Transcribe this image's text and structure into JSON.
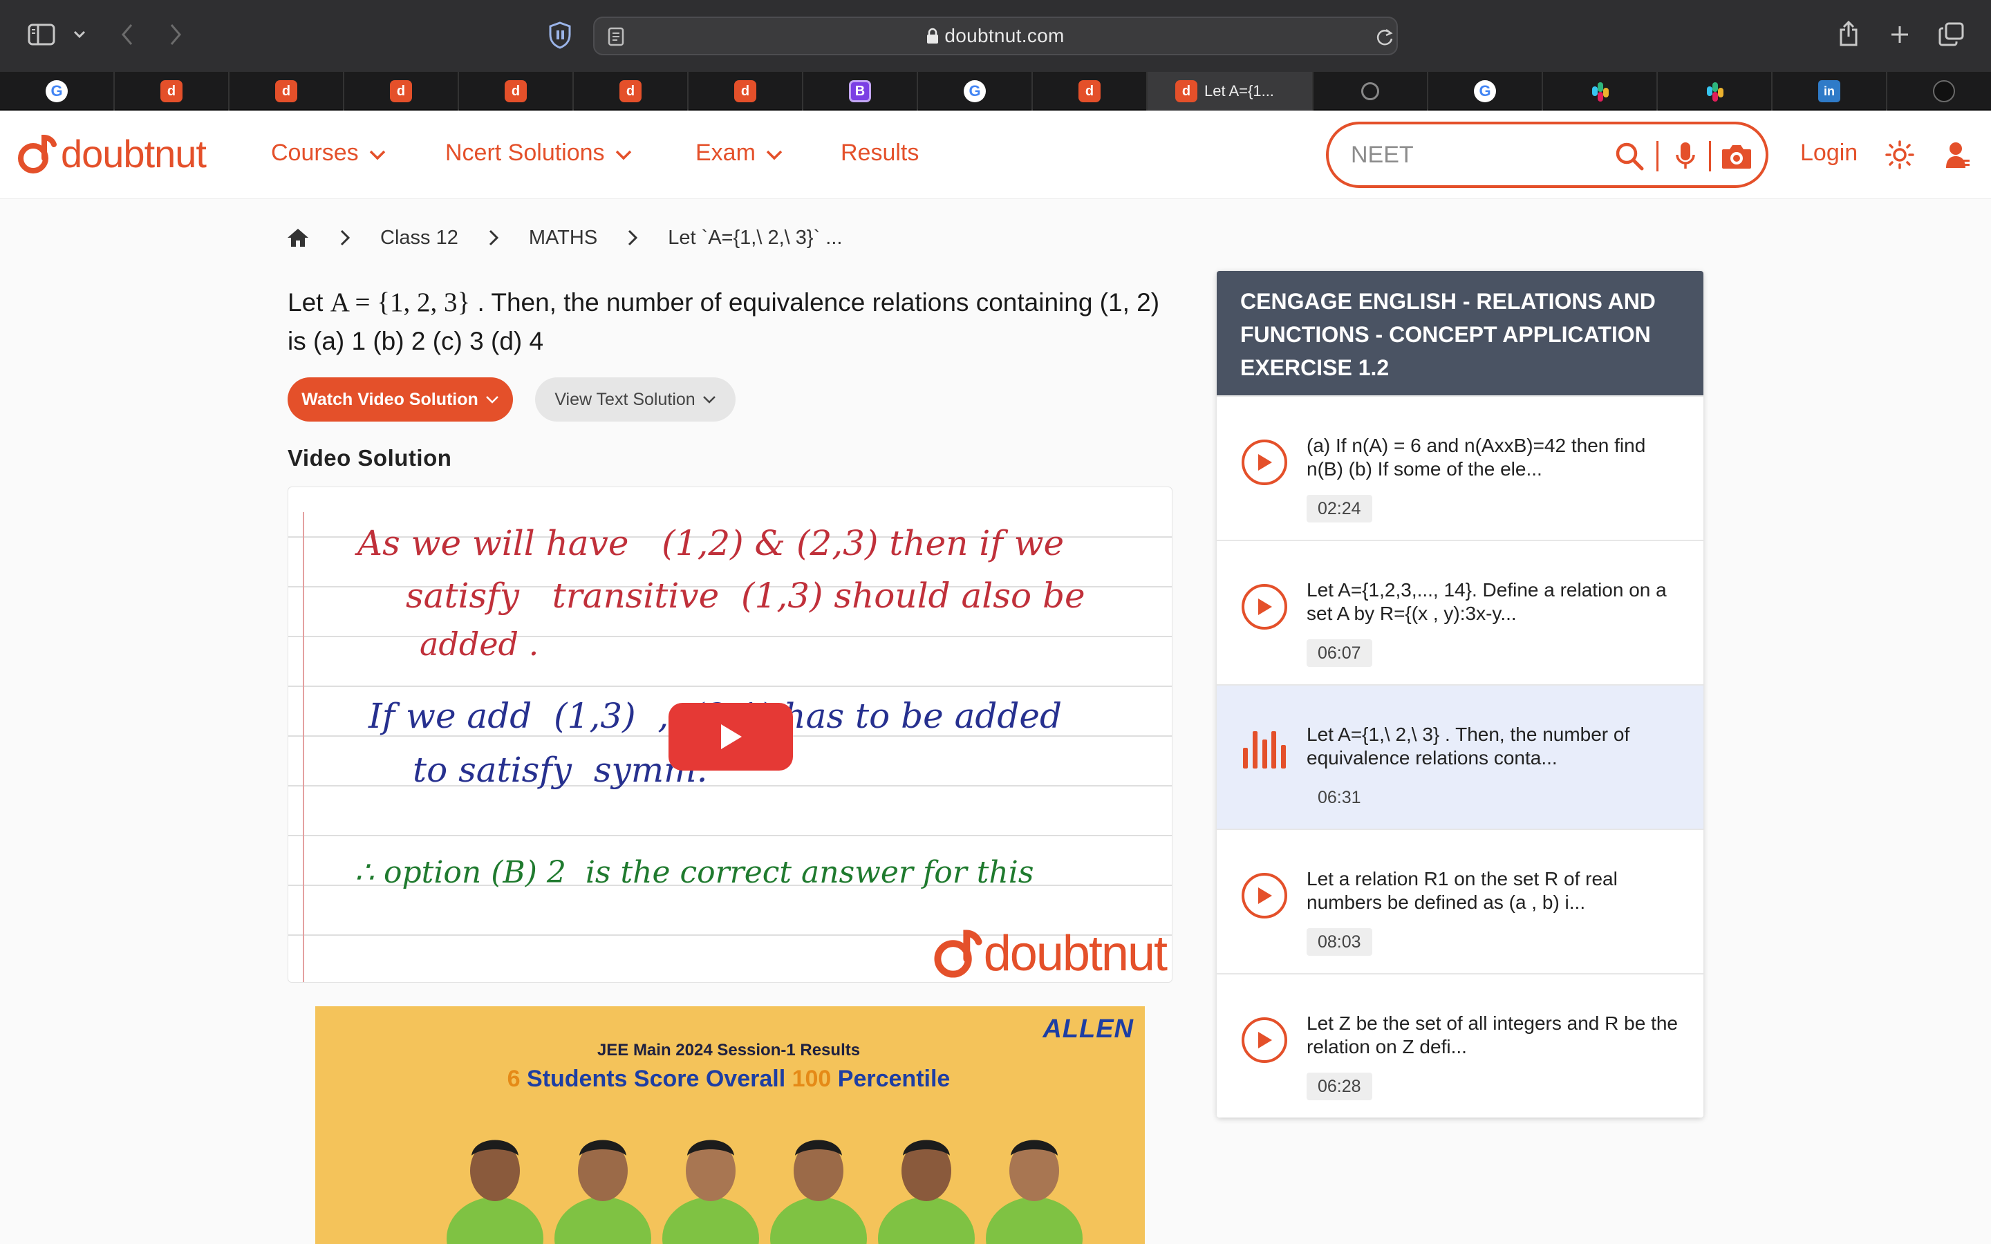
{
  "browser": {
    "url": "doubtnut.com",
    "active_tab_title": "Let A={1..."
  },
  "tabs": [
    {
      "icon": "google-favicon-icon",
      "letter": "G"
    },
    {
      "icon": "doubtnut-favicon-icon",
      "letter": "d"
    },
    {
      "icon": "doubtnut-favicon-icon",
      "letter": "d"
    },
    {
      "icon": "doubtnut-favicon-icon",
      "letter": "d"
    },
    {
      "icon": "doubtnut-favicon-icon",
      "letter": "d"
    },
    {
      "icon": "doubtnut-favicon-icon",
      "letter": "d"
    },
    {
      "icon": "doubtnut-favicon-icon",
      "letter": "d"
    },
    {
      "icon": "bootstrap-favicon-icon",
      "letter": "B"
    },
    {
      "icon": "google-favicon-icon",
      "letter": "G"
    },
    {
      "icon": "doubtnut-favicon-icon",
      "letter": "d"
    },
    {
      "icon": "doubtnut-favicon-icon",
      "letter": "d",
      "active": true
    },
    {
      "icon": "compass-favicon-icon",
      "letter": ""
    },
    {
      "icon": "google-favicon-icon",
      "letter": "G"
    },
    {
      "icon": "slack-favicon-icon",
      "letter": ""
    },
    {
      "icon": "slack-favicon-icon",
      "letter": ""
    },
    {
      "icon": "linkedin-favicon-icon",
      "letter": "in"
    },
    {
      "icon": "openai-favicon-icon",
      "letter": ""
    }
  ],
  "header": {
    "logo_text": "doubtnut",
    "nav": {
      "courses": "Courses",
      "ncert": "Ncert Solutions",
      "exam": "Exam",
      "results": "Results"
    },
    "search_placeholder": "NEET",
    "login": "Login"
  },
  "breadcrumb": {
    "class": "Class 12",
    "subject": "MATHS",
    "current": "Let `A={1,\\ 2,\\ 3}` ..."
  },
  "question": {
    "prefix": "Let ",
    "math": "A = {1,  2,  3}",
    "suffix": " . Then, the number of equivalence relations containing (1, 2) is (a) 1 (b) 2 (c) 3 (d) 4"
  },
  "buttons": {
    "watch_video": "Watch Video Solution",
    "view_text": "View Text Solution"
  },
  "video_section_title": "Video Solution",
  "video": {
    "handwriting": [
      {
        "text": "As we will have   (1,2) & (2,3) then if we",
        "color": "#c0303a"
      },
      {
        "text": "satisfy   transitive  (1,3) should also be",
        "color": "#c0303a"
      },
      {
        "text": "added .",
        "color": "#c0303a"
      },
      {
        "text": "If we add  (1,3)  ,  (3,1) has to be added",
        "color": "#26308f"
      },
      {
        "text": "to satisfy  symm.",
        "color": "#26308f"
      },
      {
        "text": "∴ option (B) 2  is the correct answer for this",
        "color": "#1f7a2e"
      }
    ],
    "watermark": "doubtnut"
  },
  "ad": {
    "brand": "ALLEN",
    "subtitle": "JEE Main 2024 Session-1 Results",
    "title_num1": "6",
    "title_mid": " Students Score Overall ",
    "title_num2": "100",
    "title_end": " Percentile"
  },
  "sidebar": {
    "heading": "CENGAGE ENGLISH  -  RELATIONS AND FUNCTIONS  -  CONCEPT APPLICATION EXERCISE 1.2",
    "items": [
      {
        "text": "(a) If n(A) = 6 and n(AxxB)=42 then find n(B) (b) If some of the ele...",
        "time": "02:24",
        "active": false
      },
      {
        "text": "Let A={1,2,3,..., 14}. Define a relation on a set A by R={(x , y):3x-y...",
        "time": "06:07",
        "active": false
      },
      {
        "text": "Let A={1,\\ 2,\\ 3} . Then, the number of equivalence relations conta...",
        "time": "06:31",
        "active": true
      },
      {
        "text": "Let a relation R1 on the set R of real numbers be defined as (a , b) i...",
        "time": "08:03",
        "active": false
      },
      {
        "text": "Let Z be the set of all integers and R be the relation on Z defi...",
        "time": "06:28",
        "active": false
      }
    ]
  },
  "colors": {
    "brand": "#e4502a",
    "sidebar_header": "#4a5363",
    "active_item": "#e8edfa",
    "play_button": "#e53935"
  }
}
